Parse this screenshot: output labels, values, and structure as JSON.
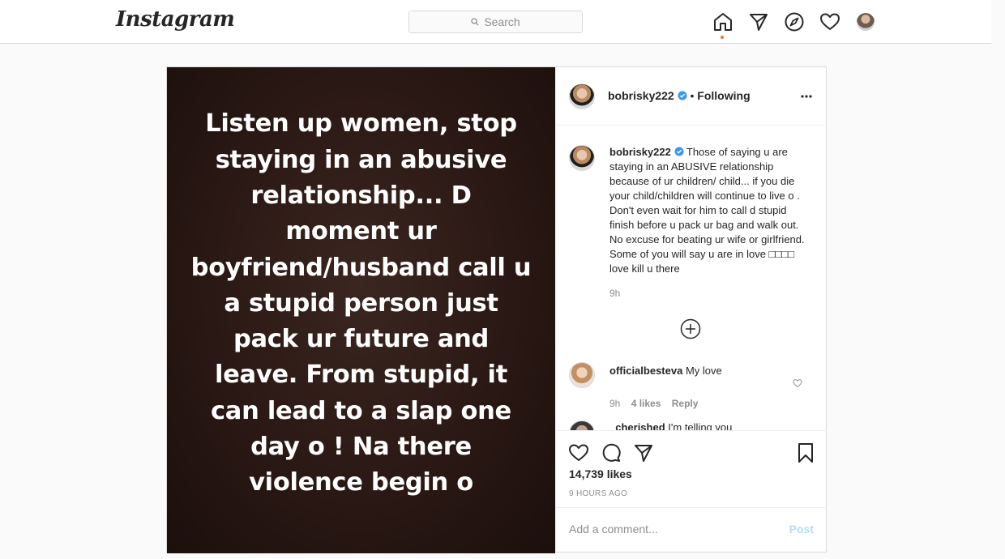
{
  "nav": {
    "logo": "Instagram",
    "search_placeholder": "Search",
    "notification_dot_color": "#e07b39"
  },
  "post": {
    "image_text": "Listen up women, stop staying in an abusive relationship... D moment ur boyfriend/husband call u a stupid person just pack ur future and leave. From stupid, it can lead to a slap one day o ! Na there violence begin o",
    "header": {
      "username": "bobrisky222",
      "separator": "•",
      "following_label": "Following"
    },
    "caption": {
      "username": "bobrisky222",
      "text": "Those of saying u are staying in an ABUSIVE relationship because of ur children/ child... if you die your child/children will continue to live o . Don't even wait for him to call d stupid finish before u pack ur bag and walk out. No excuse for beating ur wife or girlfriend. Some of you will say u are in love □□□□ love kill u there",
      "time": "9h"
    },
    "comments": [
      {
        "username": "officialbesteva",
        "text": "My love",
        "time": "9h",
        "likes": "4 likes",
        "reply": "Reply"
      },
      {
        "username": "_cherished",
        "text": "I'm telling you"
      }
    ],
    "likes_count": "14,739 likes",
    "timestamp": "9 HOURS AGO",
    "add_comment_placeholder": "Add a comment...",
    "post_button": "Post",
    "verified_color": "#3897f0"
  }
}
